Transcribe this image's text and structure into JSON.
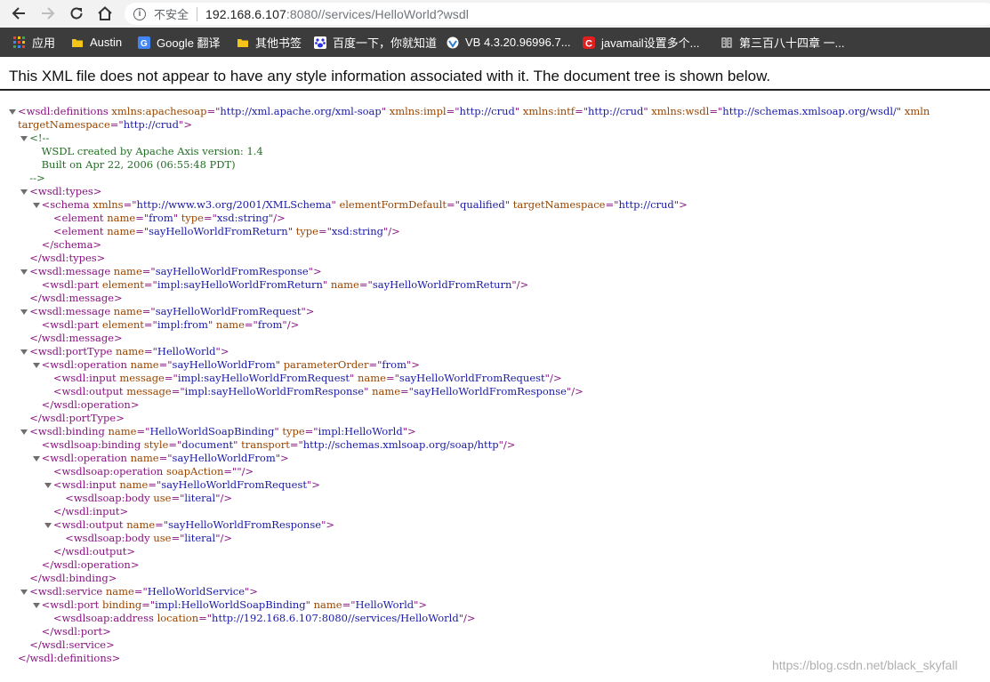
{
  "browser": {
    "security_label": "不安全",
    "url_host": "192.168.6.107",
    "url_rest": ":8080//services/HelloWorld?wsdl"
  },
  "bookmarks": [
    {
      "label": "应用",
      "icon": "apps-grid-icon"
    },
    {
      "label": "Austin",
      "icon": "folder-icon"
    },
    {
      "label": "Google 翻译",
      "icon": "google-translate-icon"
    },
    {
      "label": "其他书签",
      "icon": "folder-icon"
    },
    {
      "label": "百度一下，你就知道",
      "icon": "baidu-paw-icon"
    },
    {
      "label": "VB 4.3.20.96996.7...",
      "icon": "vb-icon"
    },
    {
      "label": "javamail设置多个...",
      "icon": "csdn-c-icon"
    },
    {
      "label": "第三百八十四章 一...",
      "icon": "book-icon"
    }
  ],
  "notice": "This XML file does not appear to have any style information associated with it. The document tree is shown below.",
  "watermark": "https://blog.csdn.net/black_skyfall",
  "colors": {
    "tag": "#881280",
    "attr_name": "#994500",
    "attr_value": "#1a1aa6",
    "comment": "#236e25",
    "bookmark_bar": "#3c3c3c"
  },
  "xml_lines": [
    {
      "indent": 0,
      "toggle": true,
      "parts": [
        [
          "t",
          "<wsdl:definitions "
        ],
        [
          "n",
          "xmlns:apachesoap"
        ],
        [
          "t",
          "=\""
        ],
        [
          "v",
          "http://xml.apache.org/xml-soap"
        ],
        [
          "t",
          "\" "
        ],
        [
          "n",
          "xmlns:impl"
        ],
        [
          "t",
          "=\""
        ],
        [
          "v",
          "http://crud"
        ],
        [
          "t",
          "\" "
        ],
        [
          "n",
          "xmlns:intf"
        ],
        [
          "t",
          "=\""
        ],
        [
          "v",
          "http://crud"
        ],
        [
          "t",
          "\" "
        ],
        [
          "n",
          "xmlns:wsdl"
        ],
        [
          "t",
          "=\""
        ],
        [
          "v",
          "http://schemas.xmlsoap.org/wsdl/"
        ],
        [
          "t",
          "\" "
        ],
        [
          "n",
          "xmln"
        ]
      ]
    },
    {
      "indent": 0,
      "parts": [
        [
          "n",
          "targetNamespace"
        ],
        [
          "t",
          "=\""
        ],
        [
          "v",
          "http://crud"
        ],
        [
          "t",
          "\">"
        ]
      ]
    },
    {
      "indent": 1,
      "toggle": true,
      "parts": [
        [
          "c",
          "<!--"
        ]
      ]
    },
    {
      "indent": 2,
      "parts": [
        [
          "c",
          "WSDL created by Apache Axis version: 1.4"
        ]
      ]
    },
    {
      "indent": 2,
      "parts": [
        [
          "c",
          "Built on Apr 22, 2006 (06:55:48 PDT)"
        ]
      ]
    },
    {
      "indent": 1,
      "parts": [
        [
          "c",
          "-->"
        ]
      ]
    },
    {
      "indent": 1,
      "toggle": true,
      "parts": [
        [
          "t",
          "<wsdl:types>"
        ]
      ]
    },
    {
      "indent": 2,
      "toggle": true,
      "parts": [
        [
          "t",
          "<schema "
        ],
        [
          "n",
          "xmlns"
        ],
        [
          "t",
          "=\""
        ],
        [
          "v",
          "http://www.w3.org/2001/XMLSchema"
        ],
        [
          "t",
          "\" "
        ],
        [
          "n",
          "elementFormDefault"
        ],
        [
          "t",
          "=\""
        ],
        [
          "v",
          "qualified"
        ],
        [
          "t",
          "\" "
        ],
        [
          "n",
          "targetNamespace"
        ],
        [
          "t",
          "=\""
        ],
        [
          "v",
          "http://crud"
        ],
        [
          "t",
          "\">"
        ]
      ]
    },
    {
      "indent": 3,
      "parts": [
        [
          "t",
          "<element "
        ],
        [
          "n",
          "name"
        ],
        [
          "t",
          "=\""
        ],
        [
          "v",
          "from"
        ],
        [
          "t",
          "\" "
        ],
        [
          "n",
          "type"
        ],
        [
          "t",
          "=\""
        ],
        [
          "v",
          "xsd:string"
        ],
        [
          "t",
          "\"/>"
        ]
      ]
    },
    {
      "indent": 3,
      "parts": [
        [
          "t",
          "<element "
        ],
        [
          "n",
          "name"
        ],
        [
          "t",
          "=\""
        ],
        [
          "v",
          "sayHelloWorldFromReturn"
        ],
        [
          "t",
          "\" "
        ],
        [
          "n",
          "type"
        ],
        [
          "t",
          "=\""
        ],
        [
          "v",
          "xsd:string"
        ],
        [
          "t",
          "\"/>"
        ]
      ]
    },
    {
      "indent": 2,
      "parts": [
        [
          "t",
          "</schema>"
        ]
      ]
    },
    {
      "indent": 1,
      "parts": [
        [
          "t",
          "</wsdl:types>"
        ]
      ]
    },
    {
      "indent": 1,
      "toggle": true,
      "parts": [
        [
          "t",
          "<wsdl:message "
        ],
        [
          "n",
          "name"
        ],
        [
          "t",
          "=\""
        ],
        [
          "v",
          "sayHelloWorldFromResponse"
        ],
        [
          "t",
          "\">"
        ]
      ]
    },
    {
      "indent": 2,
      "parts": [
        [
          "t",
          "<wsdl:part "
        ],
        [
          "n",
          "element"
        ],
        [
          "t",
          "=\""
        ],
        [
          "v",
          "impl:sayHelloWorldFromReturn"
        ],
        [
          "t",
          "\" "
        ],
        [
          "n",
          "name"
        ],
        [
          "t",
          "=\""
        ],
        [
          "v",
          "sayHelloWorldFromReturn"
        ],
        [
          "t",
          "\"/>"
        ]
      ]
    },
    {
      "indent": 1,
      "parts": [
        [
          "t",
          "</wsdl:message>"
        ]
      ]
    },
    {
      "indent": 1,
      "toggle": true,
      "parts": [
        [
          "t",
          "<wsdl:message "
        ],
        [
          "n",
          "name"
        ],
        [
          "t",
          "=\""
        ],
        [
          "v",
          "sayHelloWorldFromRequest"
        ],
        [
          "t",
          "\">"
        ]
      ]
    },
    {
      "indent": 2,
      "parts": [
        [
          "t",
          "<wsdl:part "
        ],
        [
          "n",
          "element"
        ],
        [
          "t",
          "=\""
        ],
        [
          "v",
          "impl:from"
        ],
        [
          "t",
          "\" "
        ],
        [
          "n",
          "name"
        ],
        [
          "t",
          "=\""
        ],
        [
          "v",
          "from"
        ],
        [
          "t",
          "\"/>"
        ]
      ]
    },
    {
      "indent": 1,
      "parts": [
        [
          "t",
          "</wsdl:message>"
        ]
      ]
    },
    {
      "indent": 1,
      "toggle": true,
      "parts": [
        [
          "t",
          "<wsdl:portType "
        ],
        [
          "n",
          "name"
        ],
        [
          "t",
          "=\""
        ],
        [
          "v",
          "HelloWorld"
        ],
        [
          "t",
          "\">"
        ]
      ]
    },
    {
      "indent": 2,
      "toggle": true,
      "parts": [
        [
          "t",
          "<wsdl:operation "
        ],
        [
          "n",
          "name"
        ],
        [
          "t",
          "=\""
        ],
        [
          "v",
          "sayHelloWorldFrom"
        ],
        [
          "t",
          "\" "
        ],
        [
          "n",
          "parameterOrder"
        ],
        [
          "t",
          "=\""
        ],
        [
          "v",
          "from"
        ],
        [
          "t",
          "\">"
        ]
      ]
    },
    {
      "indent": 3,
      "parts": [
        [
          "t",
          "<wsdl:input "
        ],
        [
          "n",
          "message"
        ],
        [
          "t",
          "=\""
        ],
        [
          "v",
          "impl:sayHelloWorldFromRequest"
        ],
        [
          "t",
          "\" "
        ],
        [
          "n",
          "name"
        ],
        [
          "t",
          "=\""
        ],
        [
          "v",
          "sayHelloWorldFromRequest"
        ],
        [
          "t",
          "\"/>"
        ]
      ]
    },
    {
      "indent": 3,
      "parts": [
        [
          "t",
          "<wsdl:output "
        ],
        [
          "n",
          "message"
        ],
        [
          "t",
          "=\""
        ],
        [
          "v",
          "impl:sayHelloWorldFromResponse"
        ],
        [
          "t",
          "\" "
        ],
        [
          "n",
          "name"
        ],
        [
          "t",
          "=\""
        ],
        [
          "v",
          "sayHelloWorldFromResponse"
        ],
        [
          "t",
          "\"/>"
        ]
      ]
    },
    {
      "indent": 2,
      "parts": [
        [
          "t",
          "</wsdl:operation>"
        ]
      ]
    },
    {
      "indent": 1,
      "parts": [
        [
          "t",
          "</wsdl:portType>"
        ]
      ]
    },
    {
      "indent": 1,
      "toggle": true,
      "parts": [
        [
          "t",
          "<wsdl:binding "
        ],
        [
          "n",
          "name"
        ],
        [
          "t",
          "=\""
        ],
        [
          "v",
          "HelloWorldSoapBinding"
        ],
        [
          "t",
          "\" "
        ],
        [
          "n",
          "type"
        ],
        [
          "t",
          "=\""
        ],
        [
          "v",
          "impl:HelloWorld"
        ],
        [
          "t",
          "\">"
        ]
      ]
    },
    {
      "indent": 2,
      "parts": [
        [
          "t",
          "<wsdlsoap:binding "
        ],
        [
          "n",
          "style"
        ],
        [
          "t",
          "=\""
        ],
        [
          "v",
          "document"
        ],
        [
          "t",
          "\" "
        ],
        [
          "n",
          "transport"
        ],
        [
          "t",
          "=\""
        ],
        [
          "v",
          "http://schemas.xmlsoap.org/soap/http"
        ],
        [
          "t",
          "\"/>"
        ]
      ]
    },
    {
      "indent": 2,
      "toggle": true,
      "parts": [
        [
          "t",
          "<wsdl:operation "
        ],
        [
          "n",
          "name"
        ],
        [
          "t",
          "=\""
        ],
        [
          "v",
          "sayHelloWorldFrom"
        ],
        [
          "t",
          "\">"
        ]
      ]
    },
    {
      "indent": 3,
      "parts": [
        [
          "t",
          "<wsdlsoap:operation "
        ],
        [
          "n",
          "soapAction"
        ],
        [
          "t",
          "=\"\"/>"
        ]
      ]
    },
    {
      "indent": 3,
      "toggle": true,
      "parts": [
        [
          "t",
          "<wsdl:input "
        ],
        [
          "n",
          "name"
        ],
        [
          "t",
          "=\""
        ],
        [
          "v",
          "sayHelloWorldFromRequest"
        ],
        [
          "t",
          "\">"
        ]
      ]
    },
    {
      "indent": 4,
      "parts": [
        [
          "t",
          "<wsdlsoap:body "
        ],
        [
          "n",
          "use"
        ],
        [
          "t",
          "=\""
        ],
        [
          "v",
          "literal"
        ],
        [
          "t",
          "\"/>"
        ]
      ]
    },
    {
      "indent": 3,
      "parts": [
        [
          "t",
          "</wsdl:input>"
        ]
      ]
    },
    {
      "indent": 3,
      "toggle": true,
      "parts": [
        [
          "t",
          "<wsdl:output "
        ],
        [
          "n",
          "name"
        ],
        [
          "t",
          "=\""
        ],
        [
          "v",
          "sayHelloWorldFromResponse"
        ],
        [
          "t",
          "\">"
        ]
      ]
    },
    {
      "indent": 4,
      "parts": [
        [
          "t",
          "<wsdlsoap:body "
        ],
        [
          "n",
          "use"
        ],
        [
          "t",
          "=\""
        ],
        [
          "v",
          "literal"
        ],
        [
          "t",
          "\"/>"
        ]
      ]
    },
    {
      "indent": 3,
      "parts": [
        [
          "t",
          "</wsdl:output>"
        ]
      ]
    },
    {
      "indent": 2,
      "parts": [
        [
          "t",
          "</wsdl:operation>"
        ]
      ]
    },
    {
      "indent": 1,
      "parts": [
        [
          "t",
          "</wsdl:binding>"
        ]
      ]
    },
    {
      "indent": 1,
      "toggle": true,
      "parts": [
        [
          "t",
          "<wsdl:service "
        ],
        [
          "n",
          "name"
        ],
        [
          "t",
          "=\""
        ],
        [
          "v",
          "HelloWorldService"
        ],
        [
          "t",
          "\">"
        ]
      ]
    },
    {
      "indent": 2,
      "toggle": true,
      "parts": [
        [
          "t",
          "<wsdl:port "
        ],
        [
          "n",
          "binding"
        ],
        [
          "t",
          "=\""
        ],
        [
          "v",
          "impl:HelloWorldSoapBinding"
        ],
        [
          "t",
          "\" "
        ],
        [
          "n",
          "name"
        ],
        [
          "t",
          "=\""
        ],
        [
          "v",
          "HelloWorld"
        ],
        [
          "t",
          "\">"
        ]
      ]
    },
    {
      "indent": 3,
      "parts": [
        [
          "t",
          "<wsdlsoap:address "
        ],
        [
          "n",
          "location"
        ],
        [
          "t",
          "=\""
        ],
        [
          "v",
          "http://192.168.6.107:8080//services/HelloWorld"
        ],
        [
          "t",
          "\"/>"
        ]
      ]
    },
    {
      "indent": 2,
      "parts": [
        [
          "t",
          "</wsdl:port>"
        ]
      ]
    },
    {
      "indent": 1,
      "parts": [
        [
          "t",
          "</wsdl:service>"
        ]
      ]
    },
    {
      "indent": 0,
      "parts": [
        [
          "t",
          "</wsdl:definitions>"
        ]
      ]
    }
  ]
}
